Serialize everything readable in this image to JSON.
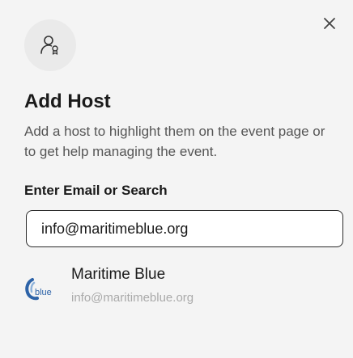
{
  "dialog": {
    "title": "Add Host",
    "description": "Add a host to highlight them on the event page or to get help managing the event.",
    "field_label": "Enter Email or Search",
    "input_value": "info@maritimeblue.org",
    "close_icon": "close-icon",
    "header_icon": "add-host-icon"
  },
  "result": {
    "name": "Maritime Blue",
    "email": "info@maritimeblue.org",
    "logo_text": "blue",
    "logo_icon": "maritime-blue-logo"
  },
  "colors": {
    "background": "#f4f4f4",
    "text": "#1a1a1a",
    "muted": "#aaaaaa",
    "logo_blue": "#2d63a8"
  }
}
